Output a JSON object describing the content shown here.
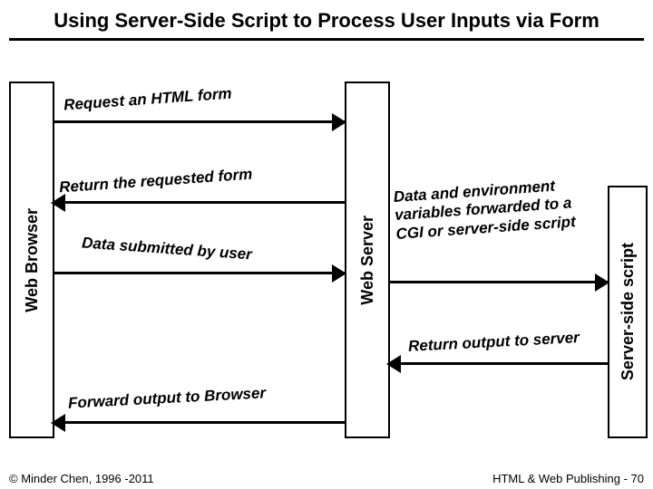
{
  "title": "Using Server-Side Script to Process User Inputs via Form",
  "boxes": {
    "browser": "Web Browser",
    "server": "Web Server",
    "script": "Server-side script"
  },
  "arrows": {
    "a1": "Request an HTML form",
    "a2": "Return the requested form",
    "a3": "Data submitted by user",
    "a4": "Data and environment variables forwarded to a CGI or server-side script",
    "a5": "Return output to server",
    "a6": "Forward output to Browser"
  },
  "footer": {
    "left": "© Minder Chen, 1996 -2011",
    "right": "HTML & Web Publishing - 70"
  }
}
